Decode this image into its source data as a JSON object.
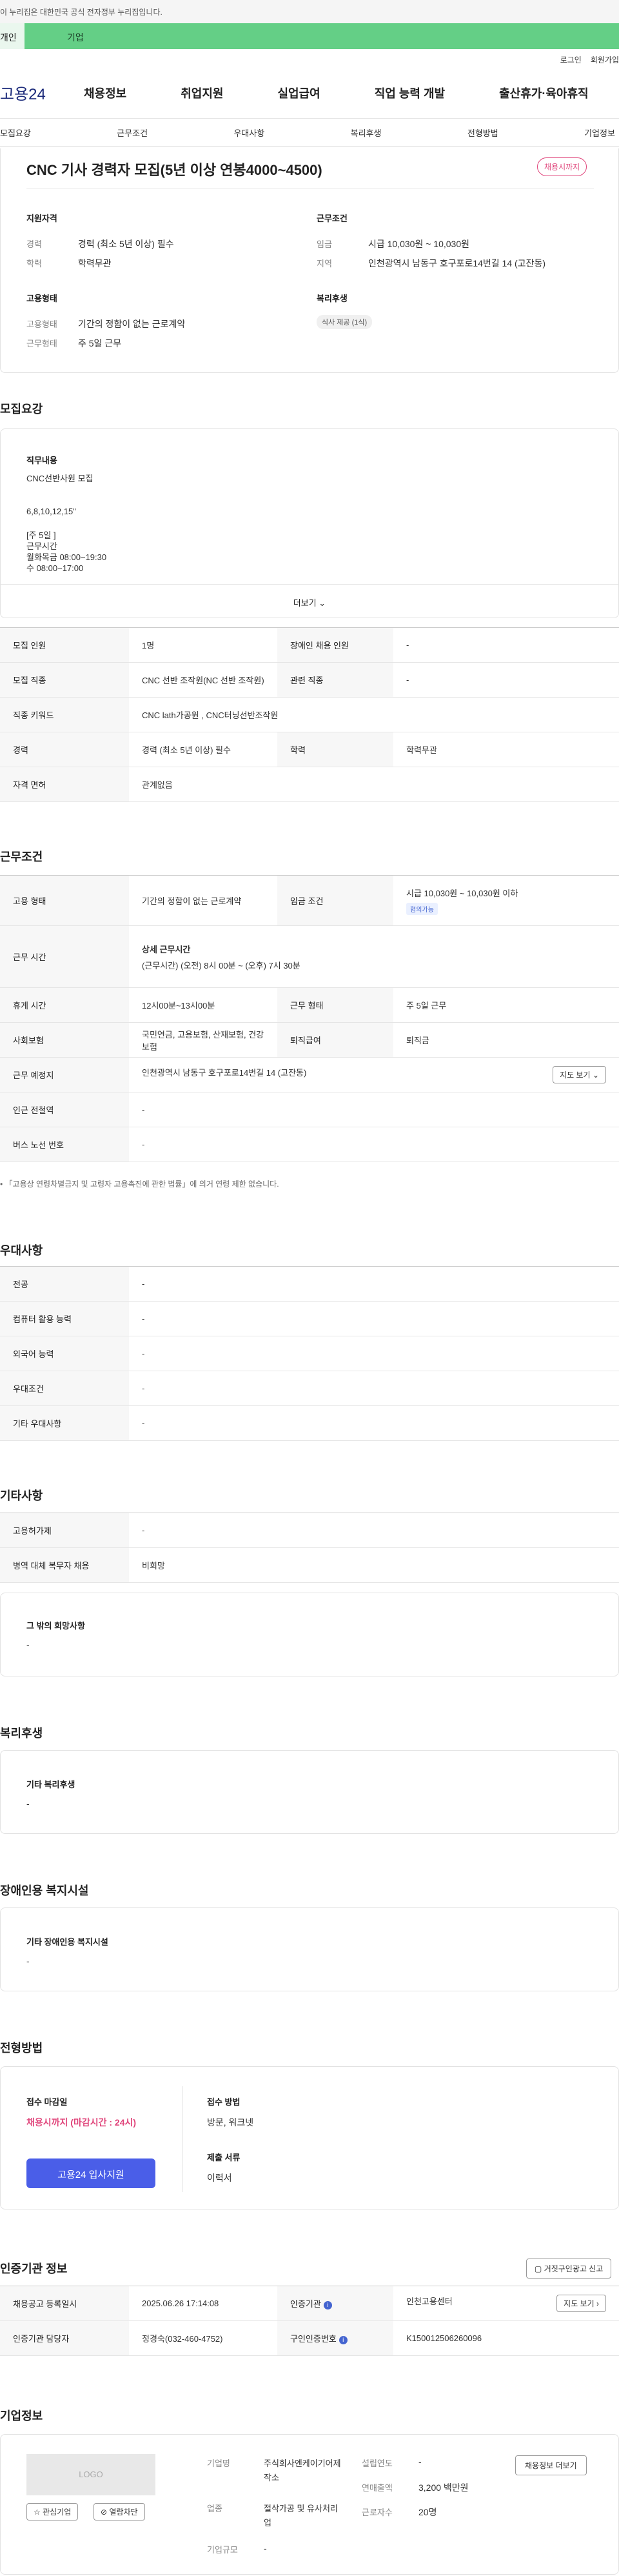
{
  "gov_banner": "이 누리집은 대한민국 공식 전자정부 누리집입니다.",
  "tabs": {
    "personal": "개인",
    "company": "기업"
  },
  "util": {
    "login": "로그인",
    "join": "회원가입"
  },
  "logo": "고용24",
  "gnb": [
    "채용정보",
    "취업지원",
    "실업급여",
    "직업 능력 개발",
    "출산휴가·육아휴직"
  ],
  "anchors": [
    "모집요강",
    "근무조건",
    "우대사항",
    "복리후생",
    "전형방법",
    "기업정보"
  ],
  "summary": {
    "title": "CNC 기사 경력자 모집(5년 이상 연봉4000~4500)",
    "badge": "채용시까지",
    "qual_title": "지원자격",
    "qual": [
      {
        "label": "경력",
        "value": "경력 (최소 5년 이상) 필수"
      },
      {
        "label": "학력",
        "value": "학력무관"
      }
    ],
    "cond_title": "근무조건",
    "cond": [
      {
        "label": "임금",
        "value": "시급 10,030원 ~ 10,030원"
      },
      {
        "label": "지역",
        "value": "인천광역시 남동구 호구포로14번길 14 (고잔동)"
      }
    ],
    "emp_title": "고용형태",
    "emp": [
      {
        "label": "고용형태",
        "value": "기간의 정함이 없는 근로계약"
      },
      {
        "label": "근무형태",
        "value": "주 5일 근무"
      }
    ],
    "welfare_title": "복리후생",
    "welfare_chip": "식사 제공 (1식)"
  },
  "recruit": {
    "section_title": "모집요강",
    "job_title": "직무내용",
    "job_lines": [
      "CNC선반사원 모집",
      "",
      "6,8,10,12,15\"",
      "",
      "[주 5일 ]",
      "근무시간",
      "월화목금 08:00~19:30",
      "수 08:00~17:00"
    ],
    "more": "더보기",
    "rows": [
      {
        "l1": "모집 인원",
        "v1": "1명",
        "l2": "장애인 채용 인원",
        "v2": "-"
      },
      {
        "l1": "모집 직종",
        "v1": "CNC 선반 조작원(NC 선반 조작원)",
        "l2": "관련 직종",
        "v2": "-"
      },
      {
        "l1": "직종 키워드",
        "v1": "CNC lath가공원 , CNC터닝선반조작원"
      },
      {
        "l1": "경력",
        "v1": "경력 (최소 5년 이상) 필수",
        "l2": "학력",
        "v2": "학력무관"
      },
      {
        "l1": "자격 면허",
        "v1": "관계없음"
      }
    ]
  },
  "conditions": {
    "section_title": "근무조건",
    "emp_label": "고용 형태",
    "emp_value": "기간의 정함이 없는 근로계약",
    "wage_label": "임금 조건",
    "wage_value": "시급 10,030원 ~ 10,030원 이하",
    "wage_chip": "협의가능",
    "hours_label": "근무 시간",
    "hours_title": "상세 근무시간",
    "hours_value": "(근무시간) (오전) 8시 00분 ~ (오후) 7시 30분",
    "break_label": "휴게 시간",
    "break_value": "12시00분~13시00분",
    "type_label": "근무 형태",
    "type_value": "주 5일 근무",
    "ins_label": "사회보험",
    "ins_value": "국민연금, 고용보험, 산재보험, 건강보험",
    "sev_label": "퇴직급여",
    "sev_value": "퇴직금",
    "place_label": "근무 예정지",
    "place_value": "인천광역시 남동구 호구포로14번길 14 (고잔동)",
    "map_btn": "지도 보기",
    "station_label": "인근 전철역",
    "station_value": "-",
    "bus_label": "버스 노선 번호",
    "bus_value": "-",
    "note": "「고용상 연령차별금지 및 고령자 고용촉진에 관한 법률」에 의거 연령 제한 없습니다."
  },
  "preference": {
    "section_title": "우대사항",
    "rows": [
      {
        "label": "전공",
        "value": "-"
      },
      {
        "label": "컴퓨터 활용 능력",
        "value": "-"
      },
      {
        "label": "외국어 능력",
        "value": "-"
      },
      {
        "label": "우대조건",
        "value": "-"
      },
      {
        "label": "기타 우대사항",
        "value": "-"
      }
    ]
  },
  "etc": {
    "section_title": "기타사항",
    "rows": [
      {
        "label": "고용허가제",
        "value": "-"
      },
      {
        "label": "병역 대체 복무자 채용",
        "value": "비희망"
      }
    ],
    "box_title": "그 밖의 희망사항",
    "box_value": "-"
  },
  "welfare": {
    "section_title": "복리후생",
    "box_title": "기타 복리후생",
    "box_value": "-"
  },
  "disabled": {
    "section_title": "장애인용 복지시설",
    "box_title": "기타 장애인용 복지시설",
    "box_value": "-"
  },
  "selection": {
    "section_title": "전형방법",
    "deadline_title": "접수 마감일",
    "deadline_value": "채용시까지 (마감시간 : 24시)",
    "apply_btn": "고용24 입사지원",
    "method_title": "접수 방법",
    "method_value": "방문, 워크넷",
    "docs_title": "제출 서류",
    "docs_value": "이력서"
  },
  "agency": {
    "section_title": "인증기관 정보",
    "report_btn": "거짓구인광고 신고",
    "reg_label": "채용공고 등록일시",
    "reg_value": "2025.06.26 17:14:08",
    "org_label": "인증기관",
    "org_value": "인천고용센터",
    "map_btn": "지도 보기",
    "mgr_label": "인증기관 담당자",
    "mgr_value": "정경숙(032-460-4752)",
    "cert_label": "구인인증번호",
    "cert_value": "K150012506260096"
  },
  "company": {
    "section_title": "기업정보",
    "logo": "LOGO",
    "fav_btn": "관심기업",
    "block_btn": "열람차단",
    "name_label": "기업명",
    "name_value": "주식회사엔케이기어제작소",
    "year_label": "설립연도",
    "year_value": "-",
    "sector_label": "업종",
    "sector_value": "절삭가공 및 유사처리업",
    "sales_label": "연매출액",
    "sales_value": "3,200 백만원",
    "staff_label": "근로자수",
    "staff_value": "20명",
    "size_label": "기업규모",
    "size_value": "-",
    "info_btn": "채용정보 더보기"
  },
  "colors": {
    "accent": "#4a5ee8",
    "green": "#64cf86",
    "pink": "#e0457b"
  }
}
